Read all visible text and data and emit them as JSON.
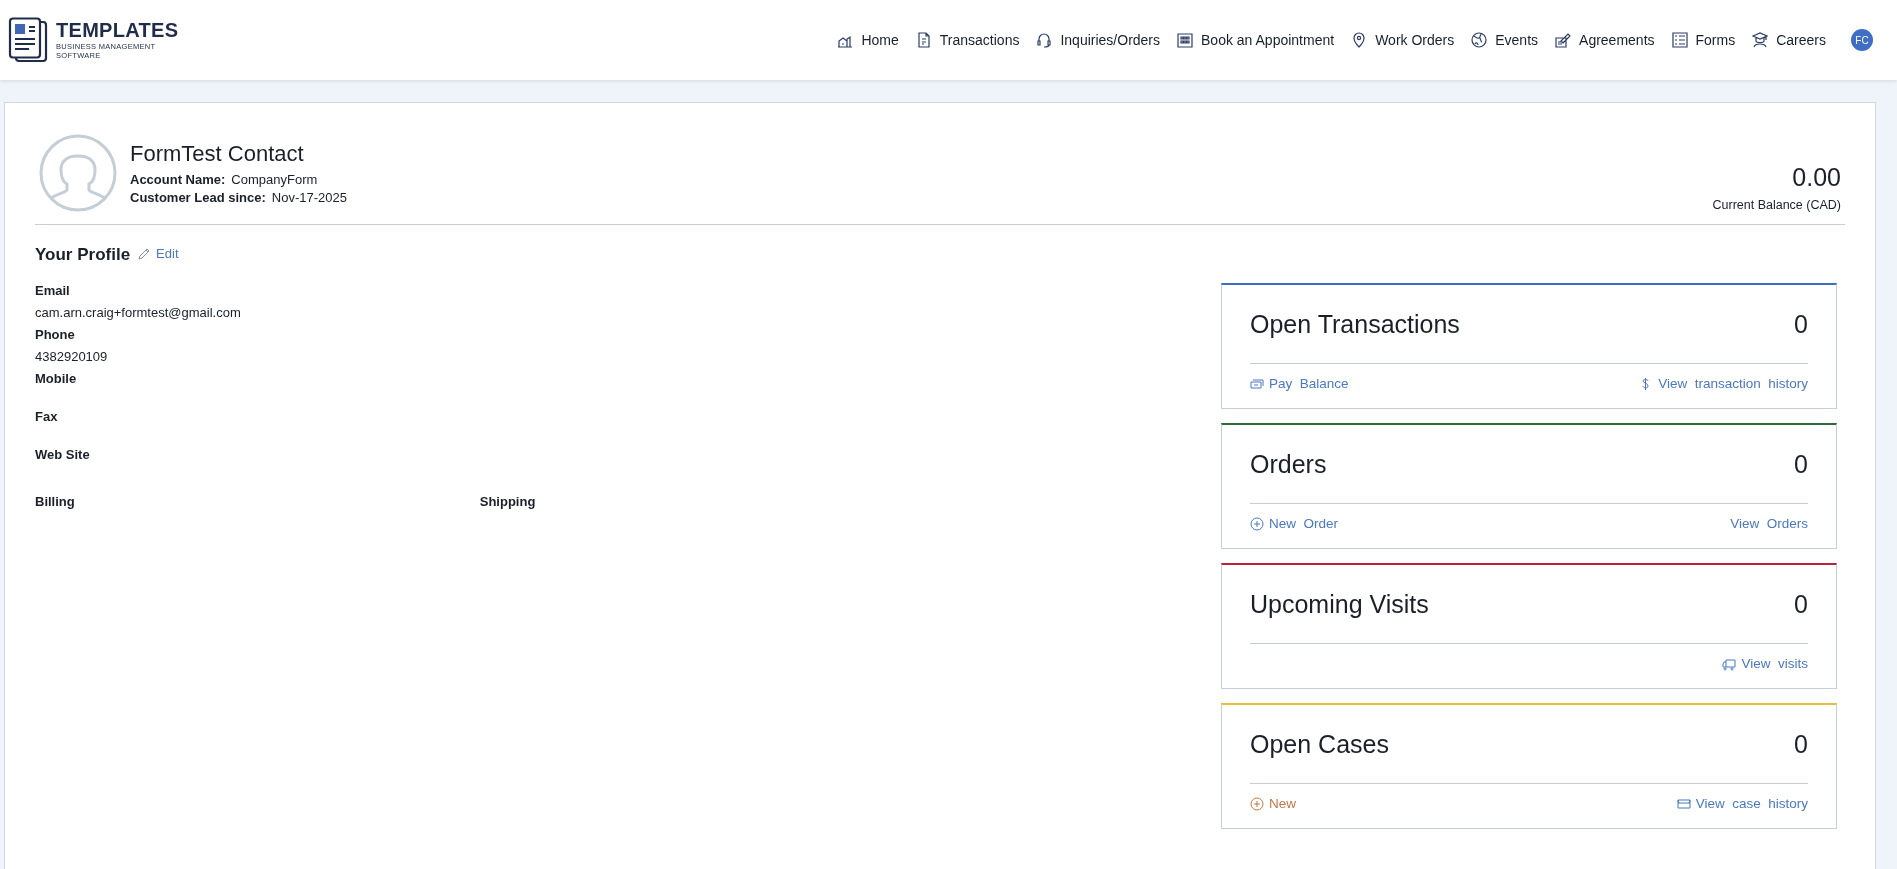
{
  "brand": {
    "name": "TEMPLATES",
    "tagline_1": "BUSINESS MANAGEMENT",
    "tagline_2": "SOFTWARE"
  },
  "nav": [
    {
      "label": "Home",
      "kind": "home"
    },
    {
      "label": "Transactions",
      "kind": "doc"
    },
    {
      "label": "Inquiries/Orders",
      "kind": "headset"
    },
    {
      "label": "Book an Appointment",
      "kind": "calendar"
    },
    {
      "label": "Work Orders",
      "kind": "pin"
    },
    {
      "label": "Events",
      "kind": "globe"
    },
    {
      "label": "Agreements",
      "kind": "sign"
    },
    {
      "label": "Forms",
      "kind": "list"
    },
    {
      "label": "Careers",
      "kind": "grad"
    }
  ],
  "user": {
    "initials": "FC"
  },
  "contact": {
    "name": "FormTest Contact",
    "account_label": "Account Name:",
    "account_value": "CompanyForm",
    "since_label": "Customer Lead since:",
    "since_value": "Nov-17-2025",
    "balance": "0.00",
    "balance_label": "Current Balance (CAD)"
  },
  "profile": {
    "title": "Your Profile",
    "edit": "Edit",
    "fields": [
      {
        "label": "Email",
        "value": "cam.arn.craig+formtest@gmail.com"
      },
      {
        "label": "Phone",
        "value": "4382920109"
      },
      {
        "label": "Mobile"
      },
      {
        "label": "Fax"
      },
      {
        "label": "Web Site"
      }
    ],
    "billing": "Billing",
    "shipping": "Shipping"
  },
  "cards": [
    {
      "title": "Open Transactions",
      "count": "0",
      "color": "#3a6fc4",
      "links_left": [
        {
          "text": "Pay  Balance",
          "kind": "money",
          "color": "#4a78c2"
        }
      ],
      "links_right": [
        {
          "text": "View  transaction  history",
          "kind": "dollar",
          "color": "#4a78c2"
        }
      ]
    },
    {
      "title": "Orders",
      "count": "0",
      "color": "#2e6b3a",
      "links_left": [
        {
          "text": "New  Order",
          "kind": "plus",
          "color": "#4a78c2"
        }
      ],
      "links_right": [
        {
          "text": "View  Orders",
          "kind": "plain",
          "color": "#4a78c2"
        }
      ]
    },
    {
      "title": "Upcoming Visits",
      "count": "0",
      "color": "#b8243a",
      "links_right": [
        {
          "text": "View  visits",
          "kind": "truck",
          "color": "#4a78c2"
        }
      ]
    },
    {
      "title": "Open Cases",
      "count": "0",
      "color": "#e8bf3a",
      "links_left": [
        {
          "text": "New",
          "kind": "plus",
          "color": "#c07a45"
        }
      ],
      "links_right": [
        {
          "text": "View  case  history",
          "kind": "tray",
          "color": "#4a78c2"
        }
      ]
    }
  ]
}
